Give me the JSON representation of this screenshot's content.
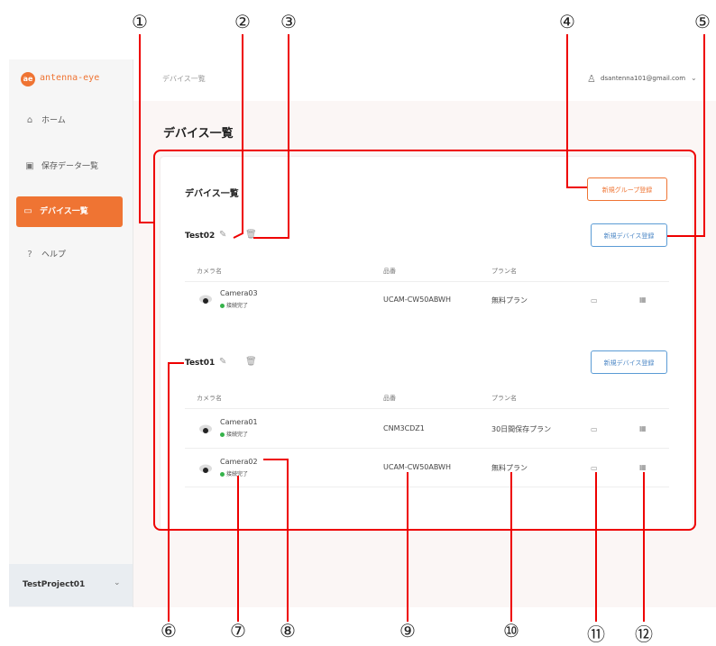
{
  "app": {
    "logo_mark": "ae",
    "logo_name": "antenna-eye"
  },
  "sidebar": {
    "items": [
      {
        "label": "ホーム",
        "icon": "home-icon",
        "active": false
      },
      {
        "label": "保存データ一覧",
        "icon": "image-icon",
        "active": false
      },
      {
        "label": "デバイス一覧",
        "icon": "camera-icon",
        "active": true
      },
      {
        "label": "ヘルプ",
        "icon": "help-icon",
        "active": false
      }
    ],
    "project": "TestProject01"
  },
  "header": {
    "breadcrumb": "デバイス一覧",
    "user_email": "dsantenna101@gmail.com"
  },
  "page": {
    "title": "デバイス一覧",
    "card_title": "デバイス一覧",
    "new_group_button": "新規グループ登録",
    "columns": {
      "camera": "カメラ名",
      "model": "品番",
      "plan": "プラン名"
    },
    "groups": [
      {
        "name": "Test02",
        "new_device_button": "新規デバイス登録",
        "rows": [
          {
            "camera": "Camera03",
            "status": "接続完了",
            "model": "UCAM-CW50ABWH",
            "plan": "無料プラン"
          }
        ]
      },
      {
        "name": "Test01",
        "new_device_button": "新規デバイス登録",
        "rows": [
          {
            "camera": "Camera01",
            "status": "接続完了",
            "model": "CNM3CDZ1",
            "plan": "30日間保存プラン"
          },
          {
            "camera": "Camera02",
            "status": "接続完了",
            "model": "UCAM-CW50ABWH",
            "plan": "無料プラン"
          }
        ]
      }
    ]
  },
  "annotations": {
    "numbers": [
      "①",
      "②",
      "③",
      "④",
      "⑤",
      "⑥",
      "⑦",
      "⑧",
      "⑨",
      "⑩",
      "⑪",
      "⑫"
    ],
    "color": "#e00000"
  },
  "colors": {
    "accent": "#ef7433",
    "link_blue": "#4a86c5",
    "status_green": "#35b24a"
  }
}
